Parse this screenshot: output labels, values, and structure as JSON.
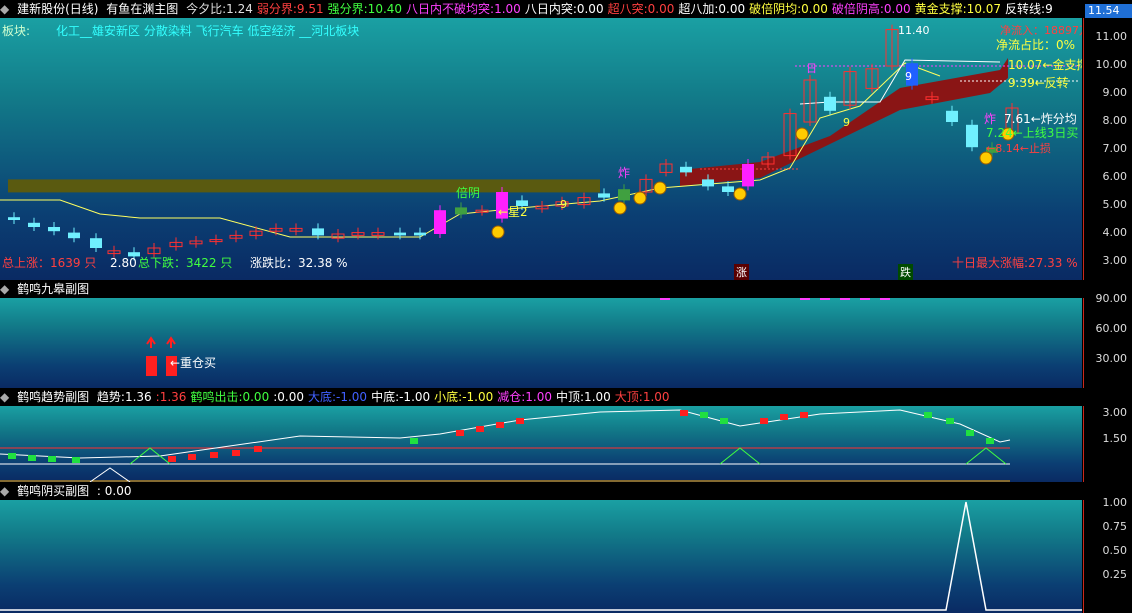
{
  "main_header": {
    "stock": "建新股份(日线)",
    "indicator": "有鱼在渊主图",
    "items": [
      {
        "label": "今夕比:",
        "value": "1.24",
        "color": "#e0e0e0"
      },
      {
        "label": "弱分界:",
        "value": "9.51",
        "color": "#ff4040"
      },
      {
        "label": "强分界:",
        "value": "10.40",
        "color": "#40ff40"
      },
      {
        "label": "八日内不破均突:",
        "value": "1.00",
        "color": "#ff40ff"
      },
      {
        "label": "八日内突:",
        "value": "0.00",
        "color": "#ffffff"
      },
      {
        "label": "超八突:",
        "value": "0.00",
        "color": "#ff4040"
      },
      {
        "label": "超八加:",
        "value": "0.00",
        "color": "#ffffff"
      },
      {
        "label": "破倍阴均:",
        "value": "0.00",
        "color": "#ffff40"
      },
      {
        "label": "破倍阴高:",
        "value": "0.00",
        "color": "#ff40ff"
      },
      {
        "label": "黄金支撑:",
        "value": "10.07",
        "color": "#ffff40"
      },
      {
        "label": "反转线:",
        "value": "9",
        "color": "#ffffff"
      }
    ],
    "price_box": "11.54"
  },
  "sector_label": "板块:",
  "sectors": "化工__雄安新区 分散染料 飞行汽车 低空经济 __河北板块",
  "main_axis": [
    "11.00",
    "10.00",
    "9.00",
    "8.00",
    "7.00",
    "6.00",
    "5.00",
    "4.00",
    "3.00"
  ],
  "annotations": {
    "high": "11.40",
    "low": "2.80",
    "net_inflow": "净流入：18897万",
    "net_inflow_ratio": "净流占比：0%",
    "gold_support": "10.07←金支撑",
    "reversal": "9.39←反转",
    "explode_split": "7.61←炸分均",
    "up_line": "7.24←上线3日买",
    "star2": "←星2",
    "bei_yin": "倍阴",
    "zha": "炸",
    "zha2": "炸",
    "nine": "9",
    "nine2": "9",
    "nine3": "9",
    "ri": "日",
    "bottom_signal": "←8.14←止损",
    "zhang": "涨",
    "die": "跌"
  },
  "stats": {
    "total_up": "总上涨：1639 只",
    "total_down": "总下跌：3422 只",
    "ratio": "涨跌比：32.38 %",
    "ten_day": "十日最大涨幅:27.33 %"
  },
  "panel2": {
    "title": "鹤鸣九皋副图",
    "axis": [
      "90.00",
      "60.00",
      "30.00"
    ],
    "heavy_buy": "←重仓买"
  },
  "panel3": {
    "title": "鹤鸣趋势副图",
    "items": [
      {
        "label": "趋势:",
        "value": "1.36",
        "color": "#ffffff"
      },
      {
        "label": ":",
        "value": "1.36",
        "color": "#ff4040"
      },
      {
        "label": "鹤鸣出击:",
        "value": "0.00",
        "color": "#40ff40"
      },
      {
        "label": ":",
        "value": "0.00",
        "color": "#ffffff"
      },
      {
        "label": "大底:",
        "value": "-1.00",
        "color": "#4060ff"
      },
      {
        "label": "中底:",
        "value": "-1.00",
        "color": "#ffffff"
      },
      {
        "label": "小底:",
        "value": "-1.00",
        "color": "#ffff40"
      },
      {
        "label": "减仓:",
        "value": "1.00",
        "color": "#ff40ff"
      },
      {
        "label": "中顶:",
        "value": "1.00",
        "color": "#ffffff"
      },
      {
        "label": "大顶:",
        "value": "1.00",
        "color": "#ff4040"
      }
    ],
    "axis": [
      "3.00",
      "1.50"
    ]
  },
  "panel4": {
    "title": "鹤鸣阴买副图",
    "value": ": 0.00",
    "axis": [
      "1.00",
      "0.75",
      "0.50",
      "0.25"
    ]
  },
  "colors": {
    "up": "#ff3030",
    "down": "#70f0ff",
    "ma": "#ffff60",
    "band": "#8a1515",
    "band2": "#5a5a00"
  }
}
